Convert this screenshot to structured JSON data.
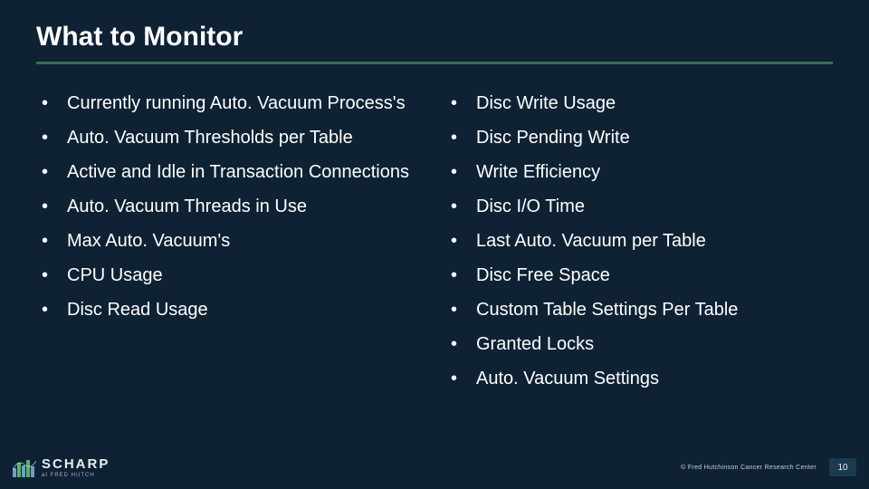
{
  "title": "What to Monitor",
  "left_items": [
    "Currently running Auto. Vacuum Process's",
    "Auto. Vacuum Thresholds per Table",
    "Active and Idle in Transaction Connections",
    "Auto. Vacuum Threads in Use",
    "Max Auto. Vacuum's",
    "CPU Usage",
    "Disc Read Usage"
  ],
  "right_items": [
    "Disc Write Usage",
    "Disc Pending Write",
    "Write Efficiency",
    "Disc I/O Time",
    "Last Auto. Vacuum per Table",
    "Disc Free Space",
    "Custom Table Settings Per Table",
    "Granted Locks",
    "Auto. Vacuum Settings"
  ],
  "logo": {
    "name": "SCHARP",
    "sub": "at FRED HUTCH"
  },
  "copyright": "© Fred Hutchinson Cancer Research Center",
  "page_number": "10"
}
